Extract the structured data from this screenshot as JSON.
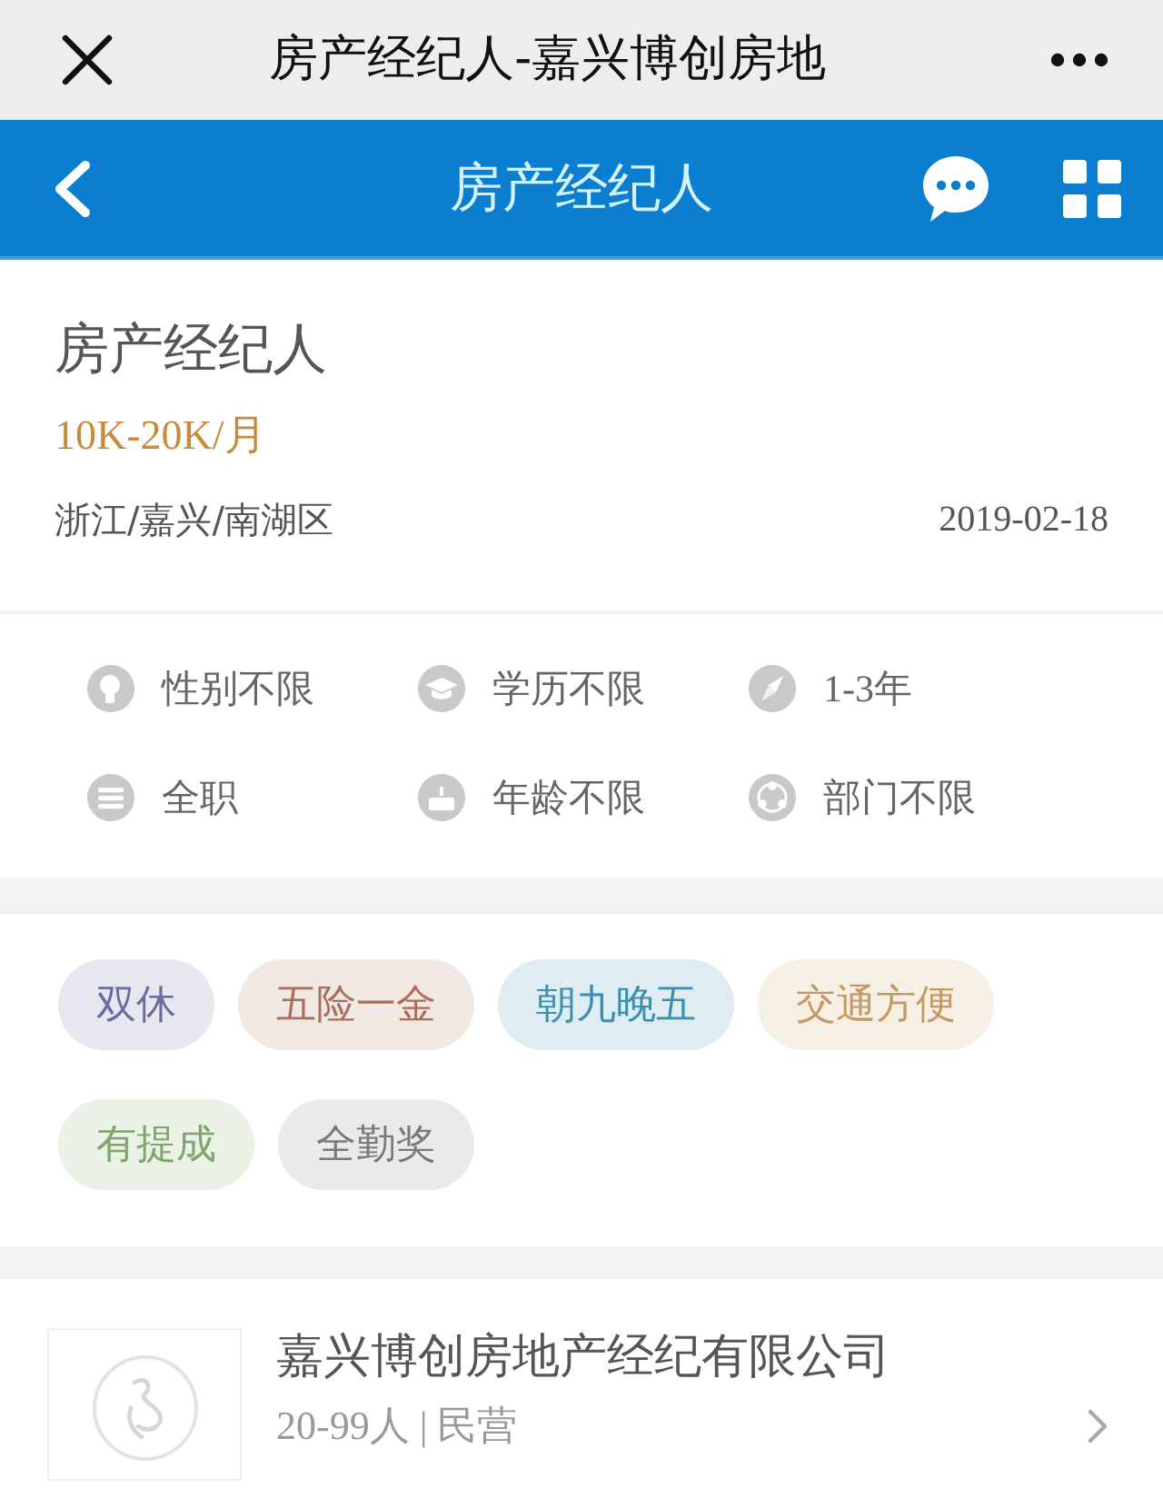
{
  "top_bar": {
    "title": "房产经纪人-嘉兴博创房地"
  },
  "nav_bar": {
    "title": "房产经纪人"
  },
  "job": {
    "title": "房产经纪人",
    "salary": "10K-20K/月",
    "location": "浙江/嘉兴/南湖区",
    "date": "2019-02-18"
  },
  "requirements": [
    {
      "kind": "gender",
      "text": "性别不限"
    },
    {
      "kind": "education",
      "text": "学历不限"
    },
    {
      "kind": "experience",
      "text": "1-3年"
    },
    {
      "kind": "job_type",
      "text": "全职"
    },
    {
      "kind": "age",
      "text": "年龄不限"
    },
    {
      "kind": "department",
      "text": "部门不限"
    }
  ],
  "benefits": [
    {
      "label": "双休",
      "color": "#6b6ba3"
    },
    {
      "label": "五险一金",
      "color": "#a8705a"
    },
    {
      "label": "朝九晚五",
      "color": "#3b8fae"
    },
    {
      "label": "交通方便",
      "color": "#c49a62"
    },
    {
      "label": "有提成",
      "color": "#7ea56c"
    },
    {
      "label": "全勤奖",
      "color": "#7a7a7a"
    }
  ],
  "company": {
    "name": "嘉兴博创房地产经纪有限公司",
    "info": "20-99人 | 民营"
  }
}
